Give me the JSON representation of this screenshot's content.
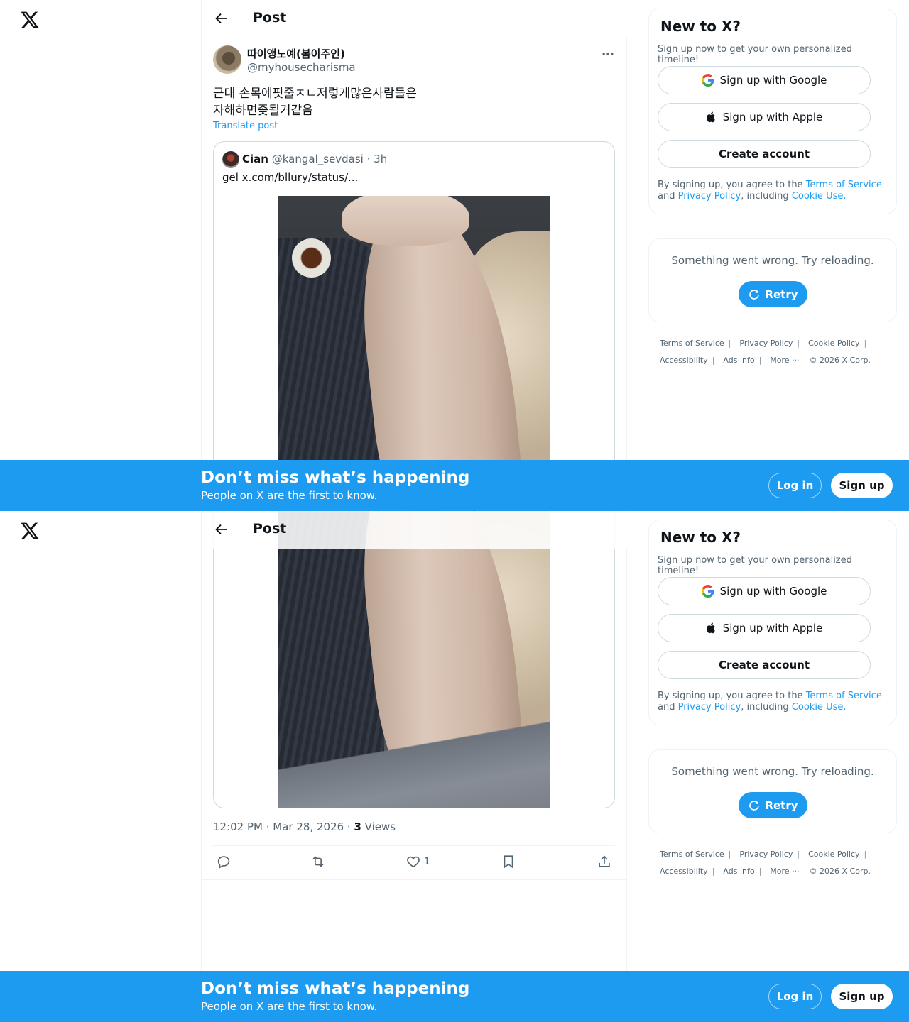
{
  "header": {
    "title": "Post"
  },
  "post": {
    "author_name": "따이앵노예(봄이주인)",
    "author_handle": "@myhousecharisma",
    "text": "근대 손목에핏줄ㅈㄴ저렇게많은사람들은\n자해하면좆될거같음",
    "translate_label": "Translate post",
    "timestamp": "12:02 PM · Mar 28, 2026 · ",
    "views_count": "3",
    "views_label": " Views",
    "likes_count": "1"
  },
  "quote": {
    "author_name": "Cian",
    "author_handle": "@kangal_sevdasi",
    "time": " · 3h",
    "text": "gel  x.com/bllury/status/..."
  },
  "signup": {
    "title": "New to X?",
    "subtitle": "Sign up now to get your own personalized timeline!",
    "google_label": "Sign up with Google",
    "apple_label": "Sign up with Apple",
    "create_label": "Create account",
    "legal_prefix": "By signing up, you agree to the ",
    "terms_link": "Terms of Service",
    "legal_and": " and ",
    "privacy_link": "Privacy Policy",
    "legal_including": ", including ",
    "cookie_link": "Cookie Use",
    "legal_end": "."
  },
  "error": {
    "text": "Something went wrong. Try reloading.",
    "retry_label": "Retry"
  },
  "footer": {
    "terms": "Terms of Service",
    "privacy": "Privacy Policy",
    "cookie": "Cookie Policy",
    "accessibility": "Accessibility",
    "ads": "Ads info",
    "more": "More ···",
    "copyright": "© 2026 X Corp."
  },
  "banner": {
    "title": "Don’t miss what’s happening",
    "subtitle": "People on X are the first to know.",
    "login_label": "Log in",
    "signup_label": "Sign up"
  },
  "colors": {
    "accent": "#1d9bf0",
    "text": "#0f1419",
    "secondary": "#536471",
    "border": "#eff3f4"
  }
}
